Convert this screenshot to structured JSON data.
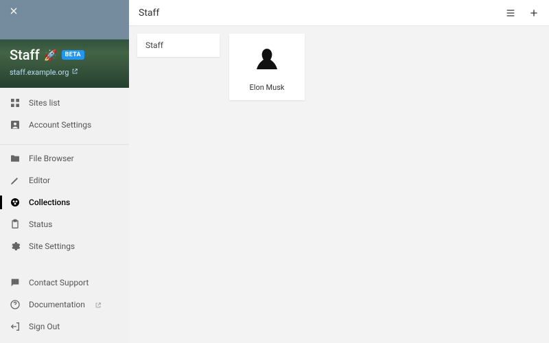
{
  "site": {
    "title": "Staff",
    "emoji": "🚀",
    "badge": "BETA",
    "domain": "staff.example.org"
  },
  "nav": {
    "groups": [
      [
        {
          "id": "sites-list",
          "label": "Sites list",
          "icon": "grid"
        },
        {
          "id": "account-settings",
          "label": "Account Settings",
          "icon": "account"
        }
      ],
      [
        {
          "id": "file-browser",
          "label": "File Browser",
          "icon": "folder"
        },
        {
          "id": "editor",
          "label": "Editor",
          "icon": "pencil"
        },
        {
          "id": "collections",
          "label": "Collections",
          "icon": "collections",
          "active": true
        },
        {
          "id": "status",
          "label": "Status",
          "icon": "clipboard"
        },
        {
          "id": "site-settings",
          "label": "Site Settings",
          "icon": "gear"
        }
      ]
    ],
    "footer": [
      {
        "id": "contact-support",
        "label": "Contact Support",
        "icon": "chat"
      },
      {
        "id": "documentation",
        "label": "Documentation",
        "icon": "help",
        "external": true
      },
      {
        "id": "sign-out",
        "label": "Sign Out",
        "icon": "signout"
      }
    ]
  },
  "page": {
    "title": "Staff"
  },
  "collections": {
    "folder": {
      "label": "Staff"
    },
    "items": [
      {
        "name": "Elon Musk"
      }
    ]
  }
}
